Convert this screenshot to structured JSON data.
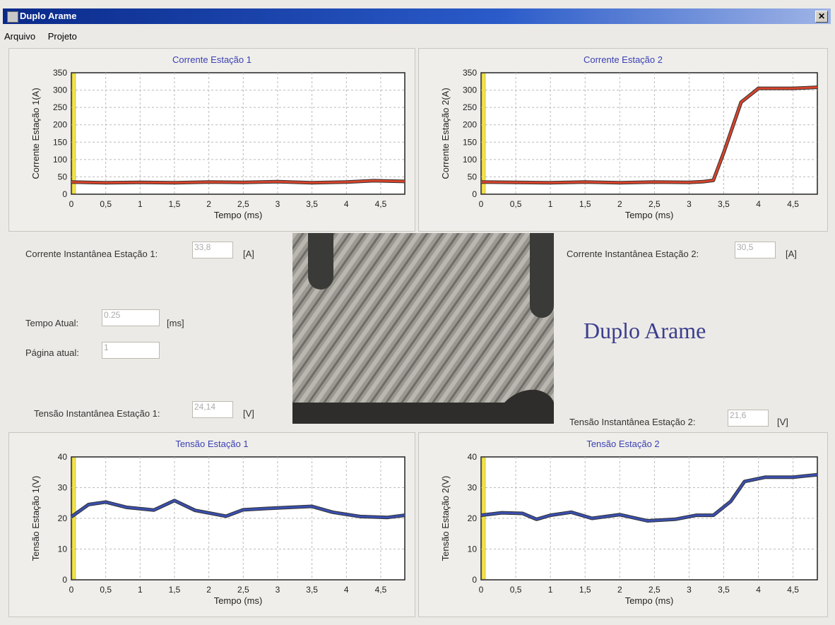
{
  "window": {
    "title": "Duplo Arame",
    "close_label": "✕"
  },
  "menu": {
    "items": [
      "Arquivo",
      "Projeto"
    ]
  },
  "brand": "Duplo Arame",
  "fields": {
    "corrente1": {
      "label": "Corrente Instantânea Estação 1:",
      "value": "33,8",
      "unit": "[A]"
    },
    "corrente2": {
      "label": "Corrente Instantânea Estação 2:",
      "value": "30,5",
      "unit": "[A]"
    },
    "tempo": {
      "label": "Tempo Atual:",
      "value": "0.25",
      "unit": "[ms]"
    },
    "pagina": {
      "label": "Página atual:",
      "value": "1"
    },
    "tensao1": {
      "label": "Tensão Instantânea Estação 1:",
      "value": "24,14",
      "unit": "[V]"
    },
    "tensao2": {
      "label": "Tensão Instantânea Estação 2:",
      "value": "21,6",
      "unit": "[V]"
    }
  },
  "colors": {
    "current_line": "#d8432a",
    "voltage_line": "#3a4fb0",
    "marker": "#f2e34c"
  },
  "chart_data": [
    {
      "type": "line",
      "title": "Corrente Estação 1",
      "xlabel": "Tempo (ms)",
      "ylabel": "Corrente Estação 1(A)",
      "xlim": [
        0,
        4.85
      ],
      "ylim": [
        0,
        350
      ],
      "xticks": [
        0,
        0.5,
        1,
        1.5,
        2,
        2.5,
        3,
        3.5,
        4,
        4.5
      ],
      "xtick_labels": [
        "0",
        "0,5",
        "1",
        "1,5",
        "2",
        "2,5",
        "3",
        "3,5",
        "4",
        "4,5"
      ],
      "yticks": [
        0,
        50,
        100,
        150,
        200,
        250,
        300,
        350
      ],
      "grid": true,
      "x": [
        0,
        0.5,
        1,
        1.5,
        2,
        2.5,
        3,
        3.5,
        4,
        4.4,
        4.85
      ],
      "y": [
        35,
        33,
        34,
        33,
        35,
        34,
        36,
        33,
        35,
        39,
        37
      ]
    },
    {
      "type": "line",
      "title": "Corrente Estação 2",
      "xlabel": "Tempo (ms)",
      "ylabel": "Corrente Estação 2(A)",
      "xlim": [
        0,
        4.85
      ],
      "ylim": [
        0,
        350
      ],
      "xticks": [
        0,
        0.5,
        1,
        1.5,
        2,
        2.5,
        3,
        3.5,
        4,
        4.5
      ],
      "xtick_labels": [
        "0",
        "0,5",
        "1",
        "1,5",
        "2",
        "2,5",
        "3",
        "3,5",
        "4",
        "4,5"
      ],
      "yticks": [
        0,
        50,
        100,
        150,
        200,
        250,
        300,
        350
      ],
      "grid": true,
      "x": [
        0,
        0.5,
        1,
        1.5,
        2,
        2.5,
        3,
        3.2,
        3.35,
        3.5,
        3.75,
        4.0,
        4.5,
        4.85
      ],
      "y": [
        35,
        34,
        33,
        35,
        33,
        35,
        34,
        36,
        40,
        120,
        265,
        305,
        305,
        308
      ]
    },
    {
      "type": "line",
      "title": "Tensão Estação 1",
      "xlabel": "Tempo (ms)",
      "ylabel": "Tensão Estação 1(V)",
      "xlim": [
        0,
        4.85
      ],
      "ylim": [
        0,
        40
      ],
      "xticks": [
        0,
        0.5,
        1,
        1.5,
        2,
        2.5,
        3,
        3.5,
        4,
        4.5
      ],
      "xtick_labels": [
        "0",
        "0,5",
        "1",
        "1,5",
        "2",
        "2,5",
        "3",
        "3,5",
        "4",
        "4,5"
      ],
      "yticks": [
        0,
        10,
        20,
        30,
        40
      ],
      "grid": true,
      "x": [
        0,
        0.25,
        0.5,
        0.8,
        1.2,
        1.5,
        1.8,
        2.25,
        2.5,
        3.0,
        3.5,
        3.8,
        4.2,
        4.6,
        4.85
      ],
      "y": [
        20.5,
        24.5,
        25.3,
        23.6,
        22.7,
        25.8,
        22.6,
        20.7,
        22.8,
        23.4,
        23.9,
        22.0,
        20.6,
        20.3,
        21.0
      ]
    },
    {
      "type": "line",
      "title": "Tensão  Estação 2",
      "xlabel": "Tempo (ms)",
      "ylabel": "Tensão Estação 2(V)",
      "xlim": [
        0,
        4.85
      ],
      "ylim": [
        0,
        40
      ],
      "xticks": [
        0,
        0.5,
        1,
        1.5,
        2,
        2.5,
        3,
        3.5,
        4,
        4.5
      ],
      "xtick_labels": [
        "0",
        "0,5",
        "1",
        "1,5",
        "2",
        "2,5",
        "3",
        "3,5",
        "4",
        "4,5"
      ],
      "yticks": [
        0,
        10,
        20,
        30,
        40
      ],
      "grid": true,
      "x": [
        0,
        0.3,
        0.6,
        0.8,
        1.0,
        1.3,
        1.6,
        2.0,
        2.4,
        2.8,
        3.1,
        3.35,
        3.6,
        3.8,
        4.1,
        4.5,
        4.85
      ],
      "y": [
        21,
        21.8,
        21.6,
        19.7,
        21.0,
        22.0,
        20.0,
        21.2,
        19.2,
        19.7,
        21.0,
        21.0,
        25.5,
        32.0,
        33.4,
        33.4,
        34.2
      ]
    }
  ]
}
